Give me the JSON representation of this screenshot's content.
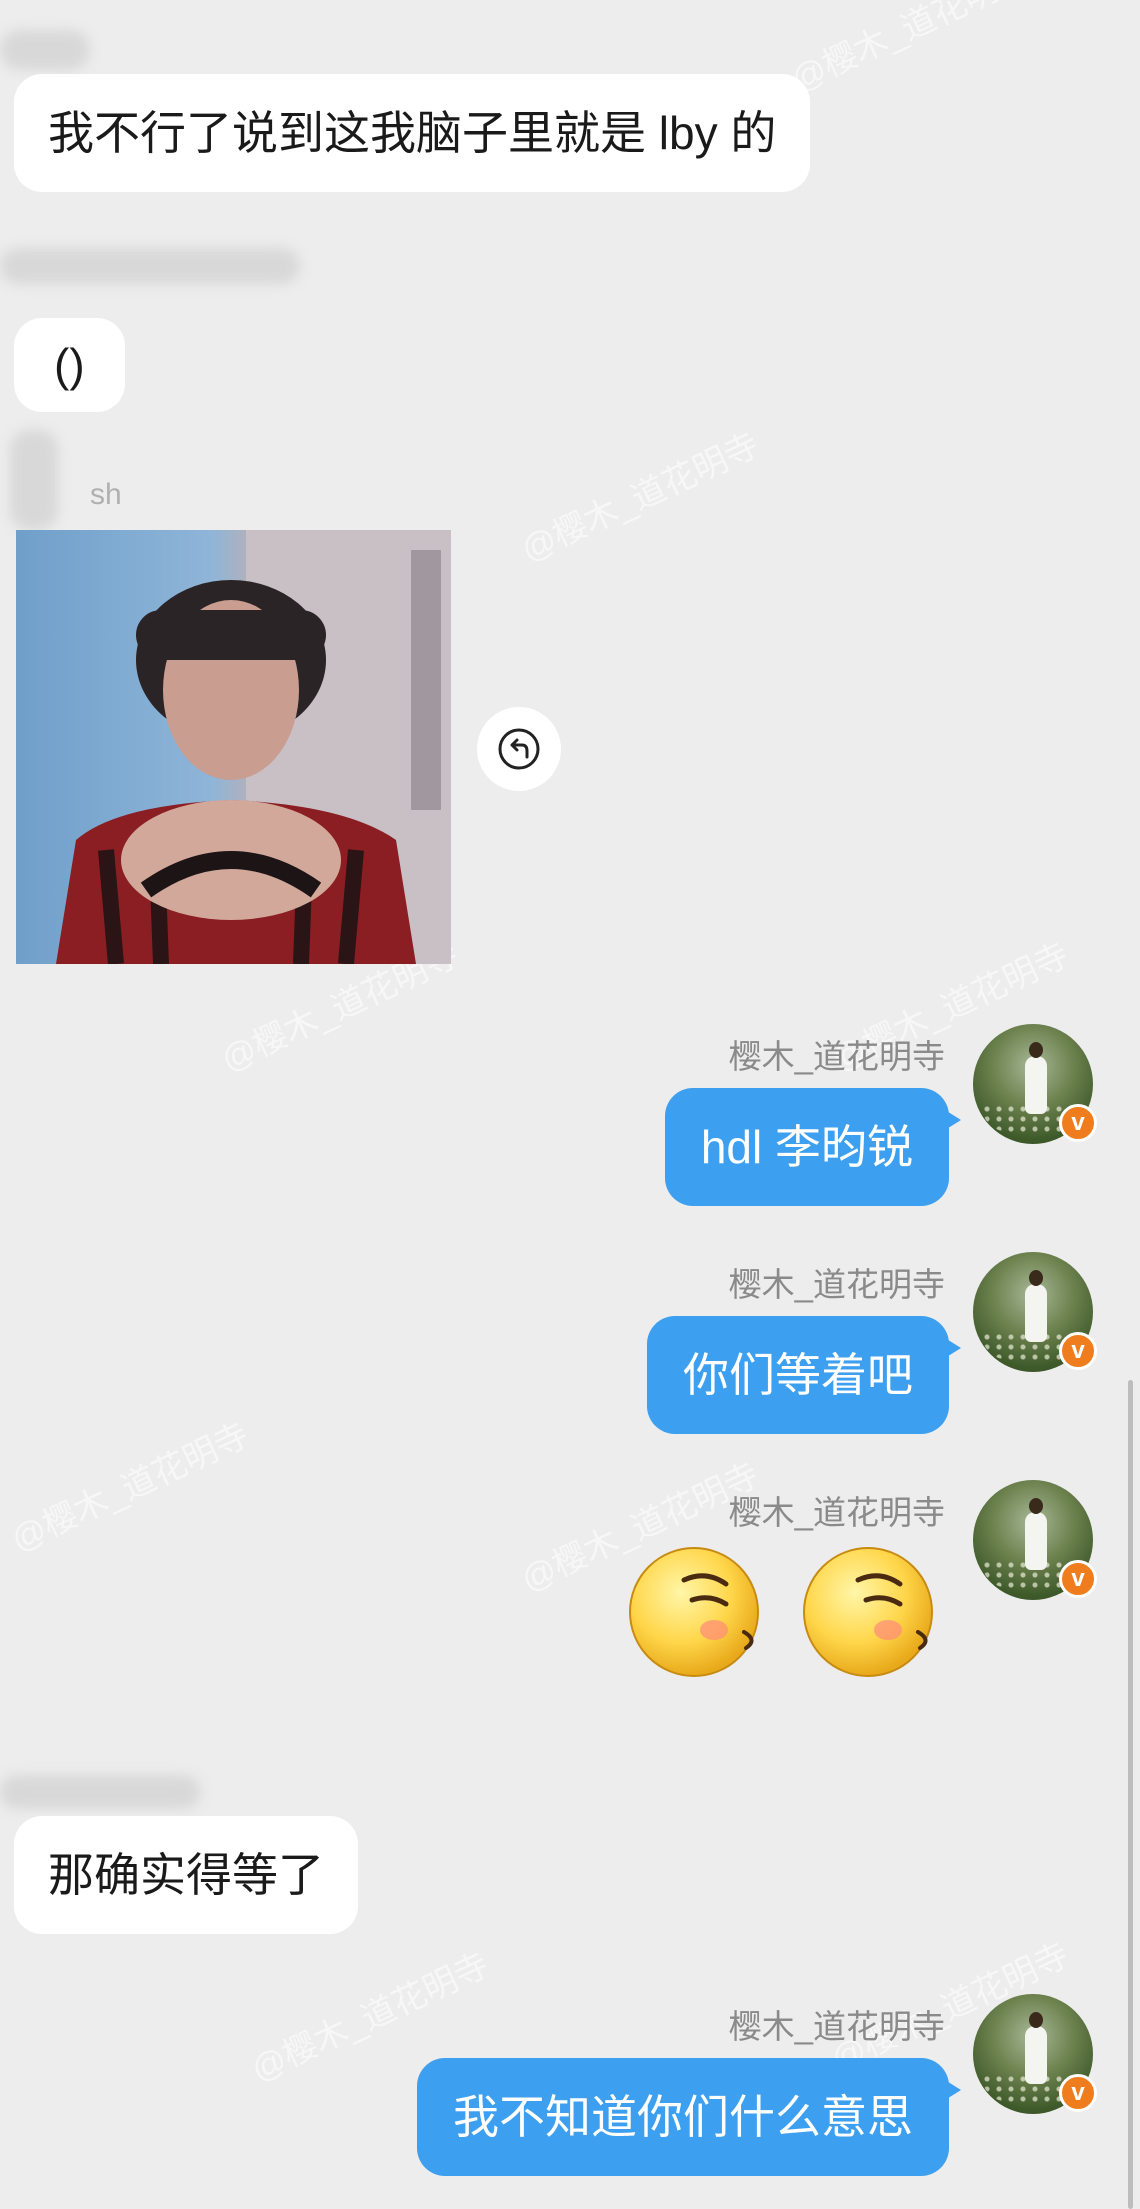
{
  "messages": {
    "m1": "我不行了说到这我脑子里就是 lby 的",
    "m2": "()",
    "m3_sender": "樱木_道花明寺",
    "m3": "hdl 李昀锐",
    "m4_sender": "樱木_道花明寺",
    "m4": "你们等着吧",
    "m5_sender": "樱木_道花明寺",
    "m6": "那确实得等了",
    "m7_sender": "樱木_道花明寺",
    "m7": "我不知道你们什么意思"
  },
  "blurred_name_fragment": "sh",
  "badge": {
    "verified_glyph": "v",
    "color": "#f07d1d"
  },
  "watermark": "@樱木_道花明寺",
  "icons": {
    "reply": "reply-icon",
    "emoji": "shy-blush-emoji"
  },
  "colors": {
    "background": "#ededed",
    "incoming_bubble": "#ffffff",
    "outgoing_bubble": "#3d9fef"
  }
}
